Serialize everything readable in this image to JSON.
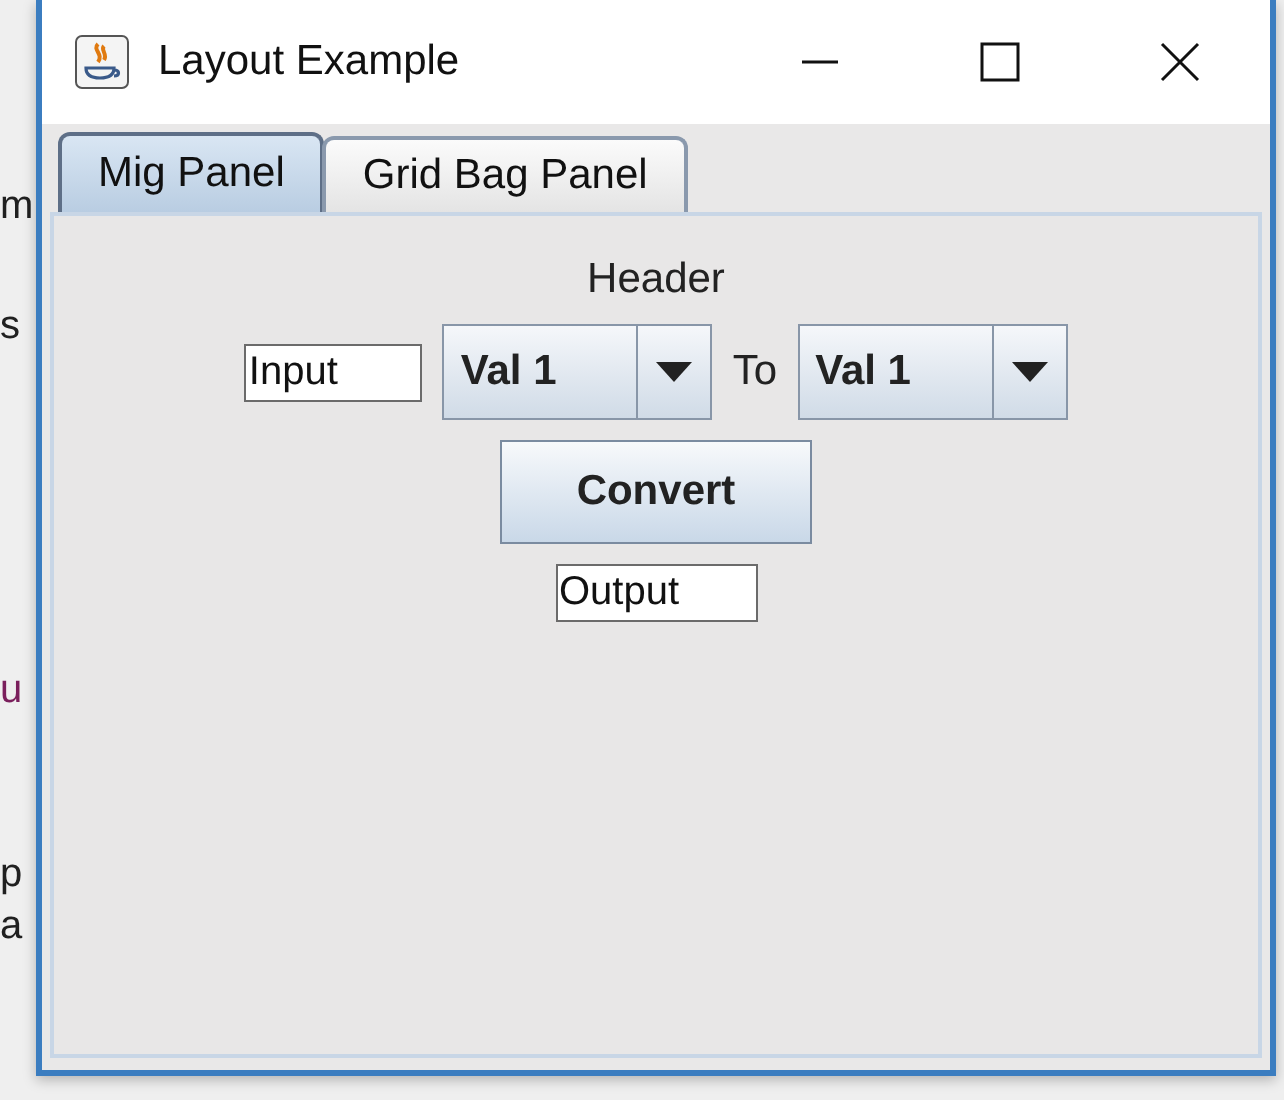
{
  "background_code": [
    {
      "text": "m",
      "color": "#202020"
    },
    {
      "text": "s",
      "color": "#202020"
    },
    {
      "text": "u",
      "color": "#7a1f5c"
    },
    {
      "text": "p",
      "color": "#202020"
    },
    {
      "text": "a",
      "color": "#202020"
    }
  ],
  "window": {
    "title": "Layout Example"
  },
  "tabs": [
    {
      "label": "Mig Panel",
      "selected": true
    },
    {
      "label": "Grid Bag Panel",
      "selected": false
    }
  ],
  "panel": {
    "header": "Header",
    "input": {
      "value": "Input"
    },
    "from_combo": {
      "value": "Val 1"
    },
    "to_label": "To",
    "to_combo": {
      "value": "Val 1"
    },
    "convert_button": "Convert",
    "output": {
      "value": "Output"
    }
  }
}
